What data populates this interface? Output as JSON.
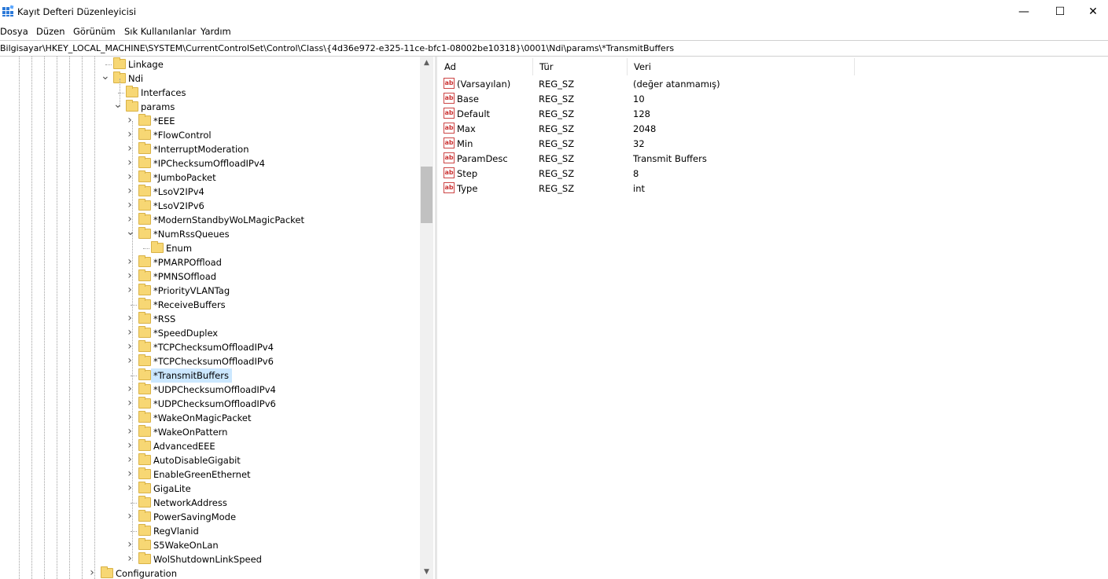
{
  "window": {
    "title": "Kayıt Defteri Düzenleyicisi",
    "minimize": "—",
    "maximize": "☐",
    "close": "✕"
  },
  "menu": [
    "Dosya",
    "Düzen",
    "Görünüm",
    "Sık Kullanılanlar",
    "Yardım"
  ],
  "address": "Bilgisayar\\HKEY_LOCAL_MACHINE\\SYSTEM\\CurrentControlSet\\Control\\Class\\{4d36e972-e325-11ce-bfc1-08002be10318}\\0001\\Ndi\\params\\*TransmitBuffers",
  "tree": [
    {
      "label": "Linkage",
      "level": 0,
      "expander": ""
    },
    {
      "label": "Ndi",
      "level": 0,
      "expander": "v"
    },
    {
      "label": "Interfaces",
      "level": 1,
      "expander": ""
    },
    {
      "label": "params",
      "level": 1,
      "expander": "v"
    },
    {
      "label": "*EEE",
      "level": 2,
      "expander": ">"
    },
    {
      "label": "*FlowControl",
      "level": 2,
      "expander": ">"
    },
    {
      "label": "*InterruptModeration",
      "level": 2,
      "expander": ">"
    },
    {
      "label": "*IPChecksumOffloadIPv4",
      "level": 2,
      "expander": ">"
    },
    {
      "label": "*JumboPacket",
      "level": 2,
      "expander": ">"
    },
    {
      "label": "*LsoV2IPv4",
      "level": 2,
      "expander": ">"
    },
    {
      "label": "*LsoV2IPv6",
      "level": 2,
      "expander": ">"
    },
    {
      "label": "*ModernStandbyWoLMagicPacket",
      "level": 2,
      "expander": ">"
    },
    {
      "label": "*NumRssQueues",
      "level": 2,
      "expander": "v"
    },
    {
      "label": "Enum",
      "level": 3,
      "expander": ""
    },
    {
      "label": "*PMARPOffload",
      "level": 2,
      "expander": ">"
    },
    {
      "label": "*PMNSOffload",
      "level": 2,
      "expander": ">"
    },
    {
      "label": "*PriorityVLANTag",
      "level": 2,
      "expander": ">"
    },
    {
      "label": "*ReceiveBuffers",
      "level": 2,
      "expander": ""
    },
    {
      "label": "*RSS",
      "level": 2,
      "expander": ">"
    },
    {
      "label": "*SpeedDuplex",
      "level": 2,
      "expander": ">"
    },
    {
      "label": "*TCPChecksumOffloadIPv4",
      "level": 2,
      "expander": ">"
    },
    {
      "label": "*TCPChecksumOffloadIPv6",
      "level": 2,
      "expander": ">"
    },
    {
      "label": "*TransmitBuffers",
      "level": 2,
      "expander": "",
      "selected": true
    },
    {
      "label": "*UDPChecksumOffloadIPv4",
      "level": 2,
      "expander": ">"
    },
    {
      "label": "*UDPChecksumOffloadIPv6",
      "level": 2,
      "expander": ">"
    },
    {
      "label": "*WakeOnMagicPacket",
      "level": 2,
      "expander": ">"
    },
    {
      "label": "*WakeOnPattern",
      "level": 2,
      "expander": ">"
    },
    {
      "label": "AdvancedEEE",
      "level": 2,
      "expander": ">"
    },
    {
      "label": "AutoDisableGigabit",
      "level": 2,
      "expander": ">"
    },
    {
      "label": "EnableGreenEthernet",
      "level": 2,
      "expander": ">"
    },
    {
      "label": "GigaLite",
      "level": 2,
      "expander": ">"
    },
    {
      "label": "NetworkAddress",
      "level": 2,
      "expander": ""
    },
    {
      "label": "PowerSavingMode",
      "level": 2,
      "expander": ">"
    },
    {
      "label": "RegVlanid",
      "level": 2,
      "expander": ""
    },
    {
      "label": "S5WakeOnLan",
      "level": 2,
      "expander": ">"
    },
    {
      "label": "WolShutdownLinkSpeed",
      "level": 2,
      "expander": ">"
    },
    {
      "label": "Configuration",
      "level": -1,
      "expander": ">"
    }
  ],
  "list": {
    "headers": {
      "name": "Ad",
      "type": "Tür",
      "data": "Veri"
    },
    "value_icon": "ab",
    "rows": [
      {
        "name": "(Varsayılan)",
        "type": "REG_SZ",
        "data": "(değer atanmamış)"
      },
      {
        "name": "Base",
        "type": "REG_SZ",
        "data": "10"
      },
      {
        "name": "Default",
        "type": "REG_SZ",
        "data": "128"
      },
      {
        "name": "Max",
        "type": "REG_SZ",
        "data": "2048"
      },
      {
        "name": "Min",
        "type": "REG_SZ",
        "data": "32"
      },
      {
        "name": "ParamDesc",
        "type": "REG_SZ",
        "data": "Transmit Buffers"
      },
      {
        "name": "Step",
        "type": "REG_SZ",
        "data": "8"
      },
      {
        "name": "Type",
        "type": "REG_SZ",
        "data": "int"
      }
    ]
  }
}
